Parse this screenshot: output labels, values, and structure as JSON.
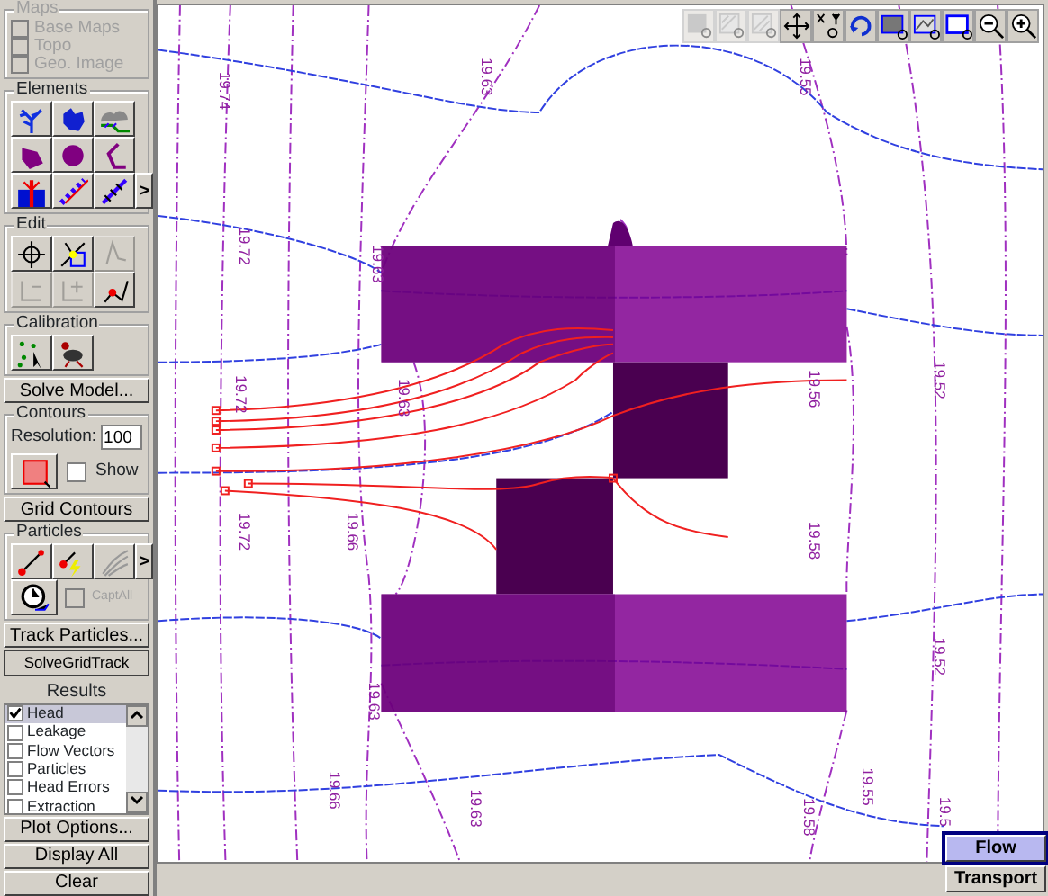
{
  "maps": {
    "title": "Maps",
    "items": [
      {
        "label": "Base Maps",
        "checked": false,
        "disabled": true
      },
      {
        "label": "Topo",
        "checked": false,
        "disabled": true
      },
      {
        "label": "Geo. Image",
        "checked": false,
        "disabled": true
      }
    ]
  },
  "elements": {
    "title": "Elements",
    "more": ">"
  },
  "edit": {
    "title": "Edit",
    "tools": [
      {
        "disabled": false
      },
      {
        "disabled": false
      },
      {
        "disabled": true
      },
      {
        "disabled": true
      },
      {
        "disabled": true
      },
      {
        "disabled": false
      }
    ]
  },
  "calibration": {
    "title": "Calibration"
  },
  "solve_button": "Solve Model...",
  "contours": {
    "title": "Contours",
    "resolution_label": "Resolution:",
    "resolution": "100",
    "show": {
      "label": "Show",
      "checked": false
    }
  },
  "grid_contours_button": "Grid Contours",
  "particles": {
    "title": "Particles",
    "more": ">",
    "capture": {
      "label": "CaptAll",
      "checked": false,
      "disabled": true
    }
  },
  "track_button": "Track Particles...",
  "solve_grid_track_button": "SolveGridTrack",
  "results": {
    "title": "Results",
    "items": [
      {
        "label": "Head",
        "checked": true,
        "selected": true
      },
      {
        "label": "Leakage",
        "checked": false,
        "selected": false
      },
      {
        "label": "Flow Vectors",
        "checked": false,
        "selected": false
      },
      {
        "label": "Particles",
        "checked": false,
        "selected": false
      },
      {
        "label": "Head Errors",
        "checked": false,
        "selected": false
      },
      {
        "label": "Extraction",
        "checked": false,
        "selected": false
      }
    ]
  },
  "plot_options_button": "Plot Options...",
  "display_all_button": "Display All",
  "clear_button": "Clear",
  "toolbar": [
    {
      "disabled": true
    },
    {
      "disabled": true
    },
    {
      "disabled": true
    },
    {
      "disabled": false
    },
    {
      "disabled": false
    },
    {
      "disabled": false
    },
    {
      "disabled": false
    },
    {
      "disabled": false
    },
    {
      "disabled": false
    },
    {
      "disabled": false
    },
    {
      "disabled": false
    }
  ],
  "contour_labels": [
    "19.74",
    "19.63",
    "19.55",
    "19.72",
    "19.63",
    "19.72",
    "19.63",
    "19.72",
    "19.66",
    "19.56",
    "19.52",
    "19.58",
    "19.52",
    "19.63",
    "19.66",
    "19.63",
    "19.58",
    "19.55",
    "19.5"
  ],
  "mode_tabs": [
    {
      "label": "Flow",
      "selected": true
    },
    {
      "label": "Transport",
      "selected": false
    }
  ]
}
